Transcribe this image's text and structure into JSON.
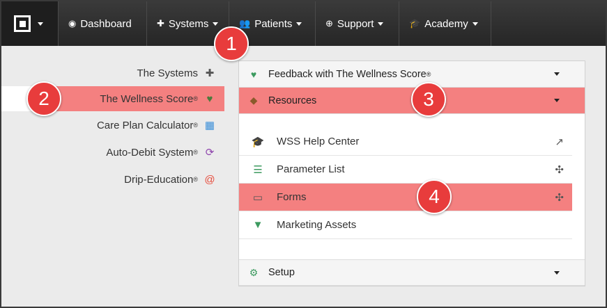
{
  "navbar": {
    "items": [
      {
        "label": "Dashboard",
        "icon": "dashboard-icon"
      },
      {
        "label": "Systems",
        "icon": "puzzle-icon"
      },
      {
        "label": "Patients",
        "icon": "users-icon"
      },
      {
        "label": "Support",
        "icon": "lifebuoy-icon"
      },
      {
        "label": "Academy",
        "icon": "graduation-cap-icon"
      }
    ]
  },
  "sidebar": {
    "items": [
      {
        "label": "The Systems",
        "icon": "puzzle-icon",
        "icon_color": "#555555"
      },
      {
        "label": "The Wellness Score",
        "reg": "®",
        "icon": "heartbeat-icon",
        "icon_color": "#4c7a3c"
      },
      {
        "label": "Care Plan Calculator",
        "reg": "®",
        "icon": "calculator-icon",
        "icon_color": "#3b8fd9"
      },
      {
        "label": "Auto-Debit System",
        "reg": "®",
        "icon": "refresh-icon",
        "icon_color": "#8e44ad"
      },
      {
        "label": "Drip-Education",
        "reg": "®",
        "icon": "at-icon",
        "icon_color": "#e74c3c"
      }
    ]
  },
  "panel": {
    "feedback": {
      "label": "Feedback with The Wellness Score",
      "reg": "®"
    },
    "resources": {
      "label": "Resources"
    },
    "setup": {
      "label": "Setup"
    },
    "rows": [
      {
        "label": "WSS Help Center",
        "icon": "graduation-cap-icon",
        "right_icon": "external-link-icon"
      },
      {
        "label": "Parameter List",
        "icon": "list-icon",
        "right_icon": "pinwheel-icon"
      },
      {
        "label": "Forms",
        "icon": "folder-open-icon",
        "right_icon": "pinwheel-icon"
      },
      {
        "label": "Marketing Assets",
        "icon": "filter-icon",
        "right_icon": ""
      }
    ]
  },
  "badges": [
    "1",
    "2",
    "3",
    "4"
  ],
  "colors": {
    "highlight": "#f48080",
    "badge": "#e83c3c",
    "navbar": "#2e2e2e"
  }
}
